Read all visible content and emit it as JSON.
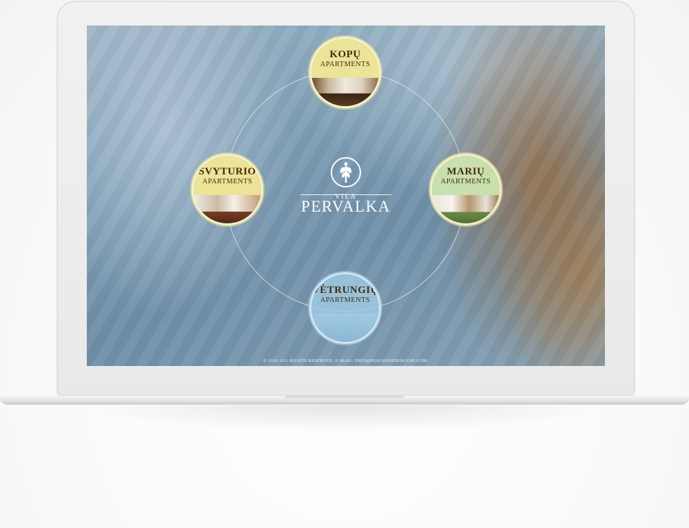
{
  "brand": {
    "prefix": "VILA",
    "name": "PERVALKA"
  },
  "apartments": [
    {
      "name": "KOPŲ",
      "sub": "APARTMENTS"
    },
    {
      "name": "MARIŲ",
      "sub": "APARTMENTS"
    },
    {
      "name": "ŠVYTURIO",
      "sub": "APARTMENTS"
    },
    {
      "name": "VĖTRUNGIŲ",
      "sub": "APARTMENTS"
    }
  ],
  "footer": {
    "text": "© 2016 ALL RIGHTS RESERVED. E-MAIL: INFO@POILSISNERINGOJE.COM."
  },
  "colors": {
    "yellow_badge": "#f2e896",
    "green_badge": "#cde6af",
    "blue_badge": "#a0cde6",
    "label_text": "#4a2a10"
  }
}
